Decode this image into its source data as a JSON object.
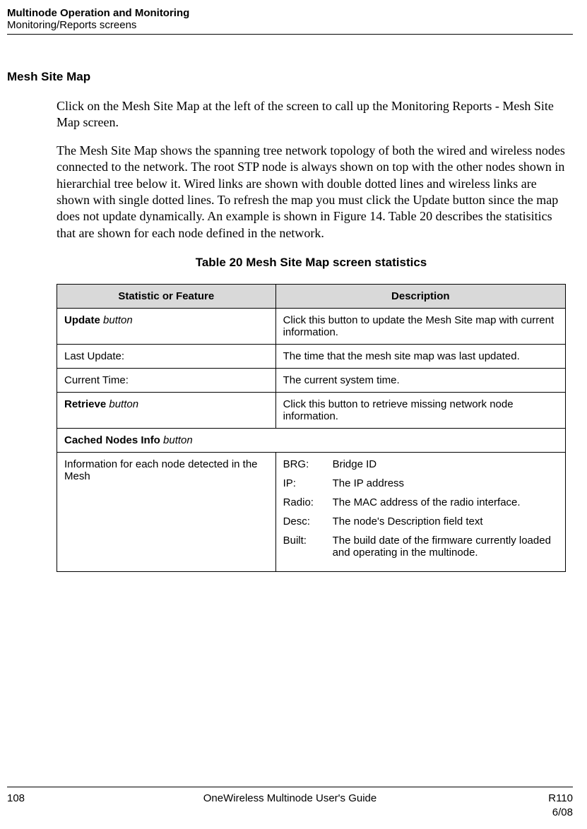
{
  "header": {
    "line1": "Multinode Operation and Monitoring",
    "line2": "Monitoring/Reports screens"
  },
  "section": {
    "title": "Mesh Site Map",
    "para1": "Click on the Mesh Site Map at the left of the screen to call up the Monitoring Reports - Mesh Site Map screen.",
    "para2": "The Mesh Site Map shows the spanning tree network topology of both the wired and wireless nodes connected to the network. The root STP node is always shown on top with the other nodes shown in hierarchial tree below it. Wired links are shown with double dotted lines and wireless links are shown with single dotted lines. To refresh the map you must click the Update button since the map does not update dynamically. An example is shown in Figure 14. Table 20 describes the statisitics that are shown for each node defined in the network."
  },
  "table": {
    "caption": "Table 20  Mesh Site Map screen statistics",
    "header": {
      "col1": "Statistic or Feature",
      "col2": "Description"
    },
    "rows": {
      "r1": {
        "stat_bold": "Update",
        "stat_italic": " button",
        "desc": "Click this button to update the Mesh Site map with current information."
      },
      "r2": {
        "stat": "Last Update:",
        "desc": "The time that the mesh site map was last updated."
      },
      "r3": {
        "stat": "Current Time:",
        "desc": "The current system time."
      },
      "r4": {
        "stat_bold": "Retrieve",
        "stat_italic": " button",
        "desc": "Click this button to retrieve missing network node information."
      },
      "r5": {
        "stat_bold": "Cached Nodes Info",
        "stat_italic": " button"
      },
      "r6": {
        "stat": "Information for each node detected in the Mesh",
        "items": {
          "i1": {
            "key": "BRG:",
            "val": "Bridge ID"
          },
          "i2": {
            "key": "IP:",
            "val": "The IP address"
          },
          "i3": {
            "key": "Radio:",
            "val": "The MAC address of the radio interface."
          },
          "i4": {
            "key": "Desc:",
            "val": "The node's Description field text"
          },
          "i5": {
            "key": "Built:",
            "val": "The build date of the firmware currently loaded and operating in the multinode."
          }
        }
      }
    }
  },
  "footer": {
    "page": "108",
    "center": "OneWireless Multinode User's Guide",
    "right1": "R110",
    "right2": "6/08"
  }
}
